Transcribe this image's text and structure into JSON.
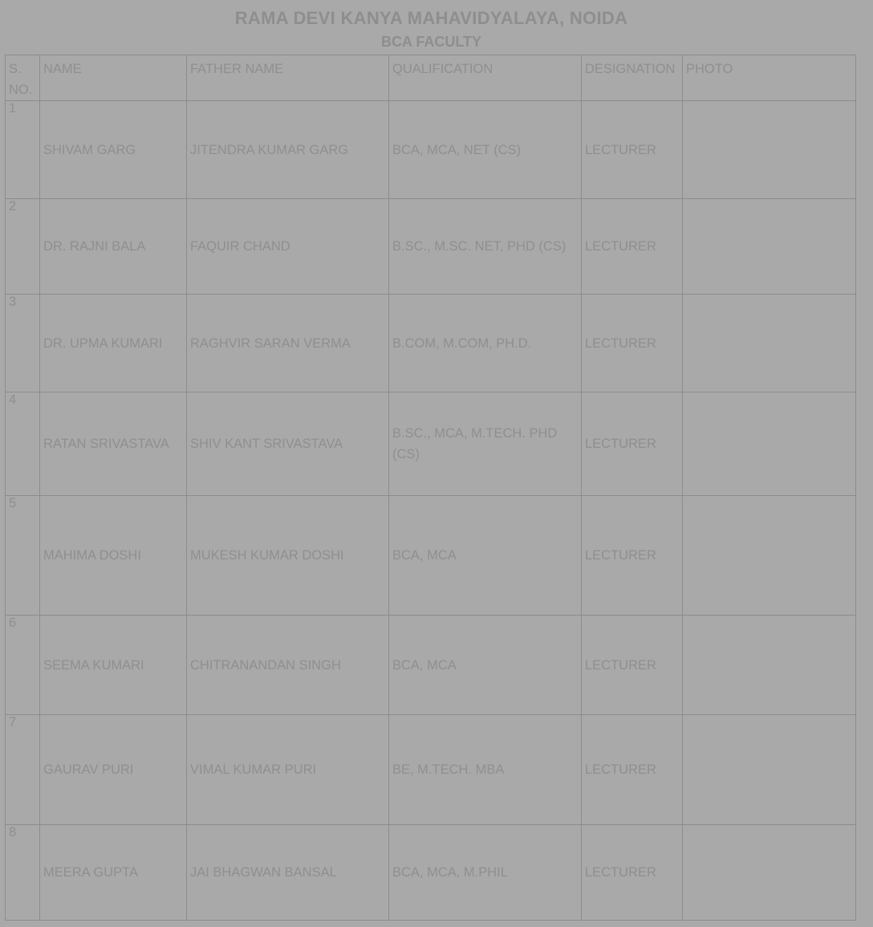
{
  "header": {
    "title": "RAMA DEVI KANYA MAHAVIDYALAYA, NOIDA",
    "subtitle": "BCA FACULTY"
  },
  "table": {
    "columns": [
      "S. NO.",
      "NAME",
      "FATHER NAME",
      "QUALIFICATION",
      "DESIGNATION",
      "PHOTO"
    ],
    "rows": [
      {
        "sno": "1",
        "name": "SHIVAM GARG",
        "father": "JITENDRA KUMAR GARG",
        "qualification": "BCA, MCA, NET (CS)",
        "designation": "LECTURER",
        "photo_bg": "#b0b0b0",
        "photo_body": "#a8a8a8"
      },
      {
        "sno": "2",
        "name": "DR. RAJNI BALA",
        "father": "FAQUIR CHAND",
        "qualification": "B.SC., M.SC. NET, PHD (CS)",
        "designation": "LECTURER",
        "photo_bg": "#aaaaaa",
        "photo_body": "#a8747a"
      },
      {
        "sno": "3",
        "name": "DR. UPMA KUMARI",
        "father": "RAGHVIR SARAN VERMA",
        "qualification": "B.COM, M.COM, PH.D.",
        "designation": "LECTURER",
        "photo_bg": "#a7a7a7",
        "photo_body": "#6c6a6a"
      },
      {
        "sno": "4",
        "name": "RATAN SRIVASTAVA",
        "father": "SHIV KANT SRIVASTAVA",
        "qualification": "B.SC., MCA, M.TECH. PHD (CS)",
        "designation": "LECTURER",
        "photo_bg": "#a2a4b2",
        "photo_body": "#ad9fa3"
      },
      {
        "sno": "5",
        "name": "MAHIMA DOSHI",
        "father": "MUKESH KUMAR DOSHI",
        "qualification": "BCA, MCA",
        "designation": "LECTURER",
        "photo_bg": "#a5a5a5",
        "photo_body": "#7a7470"
      },
      {
        "sno": "6",
        "name": "SEEMA KUMARI",
        "father": "CHITRANANDAN SINGH",
        "qualification": "BCA, MCA",
        "designation": "LECTURER",
        "photo_bg": "#a8a8a8",
        "photo_body": "#8b8584"
      },
      {
        "sno": "7",
        "name": "GAURAV PURI",
        "father": "VIMAL KUMAR PURI",
        "qualification": "BE, M.TECH. MBA",
        "designation": "LECTURER",
        "photo_bg": "#acacac",
        "photo_body": "#a9a9a9"
      },
      {
        "sno": "8",
        "name": "MEERA GUPTA",
        "father": "JAI BHAGWAN BANSAL",
        "qualification": "BCA, MCA, M.PHIL",
        "designation": "LECTURER",
        "photo_bg": "#adadad",
        "photo_body": "#ad6f70"
      }
    ]
  }
}
